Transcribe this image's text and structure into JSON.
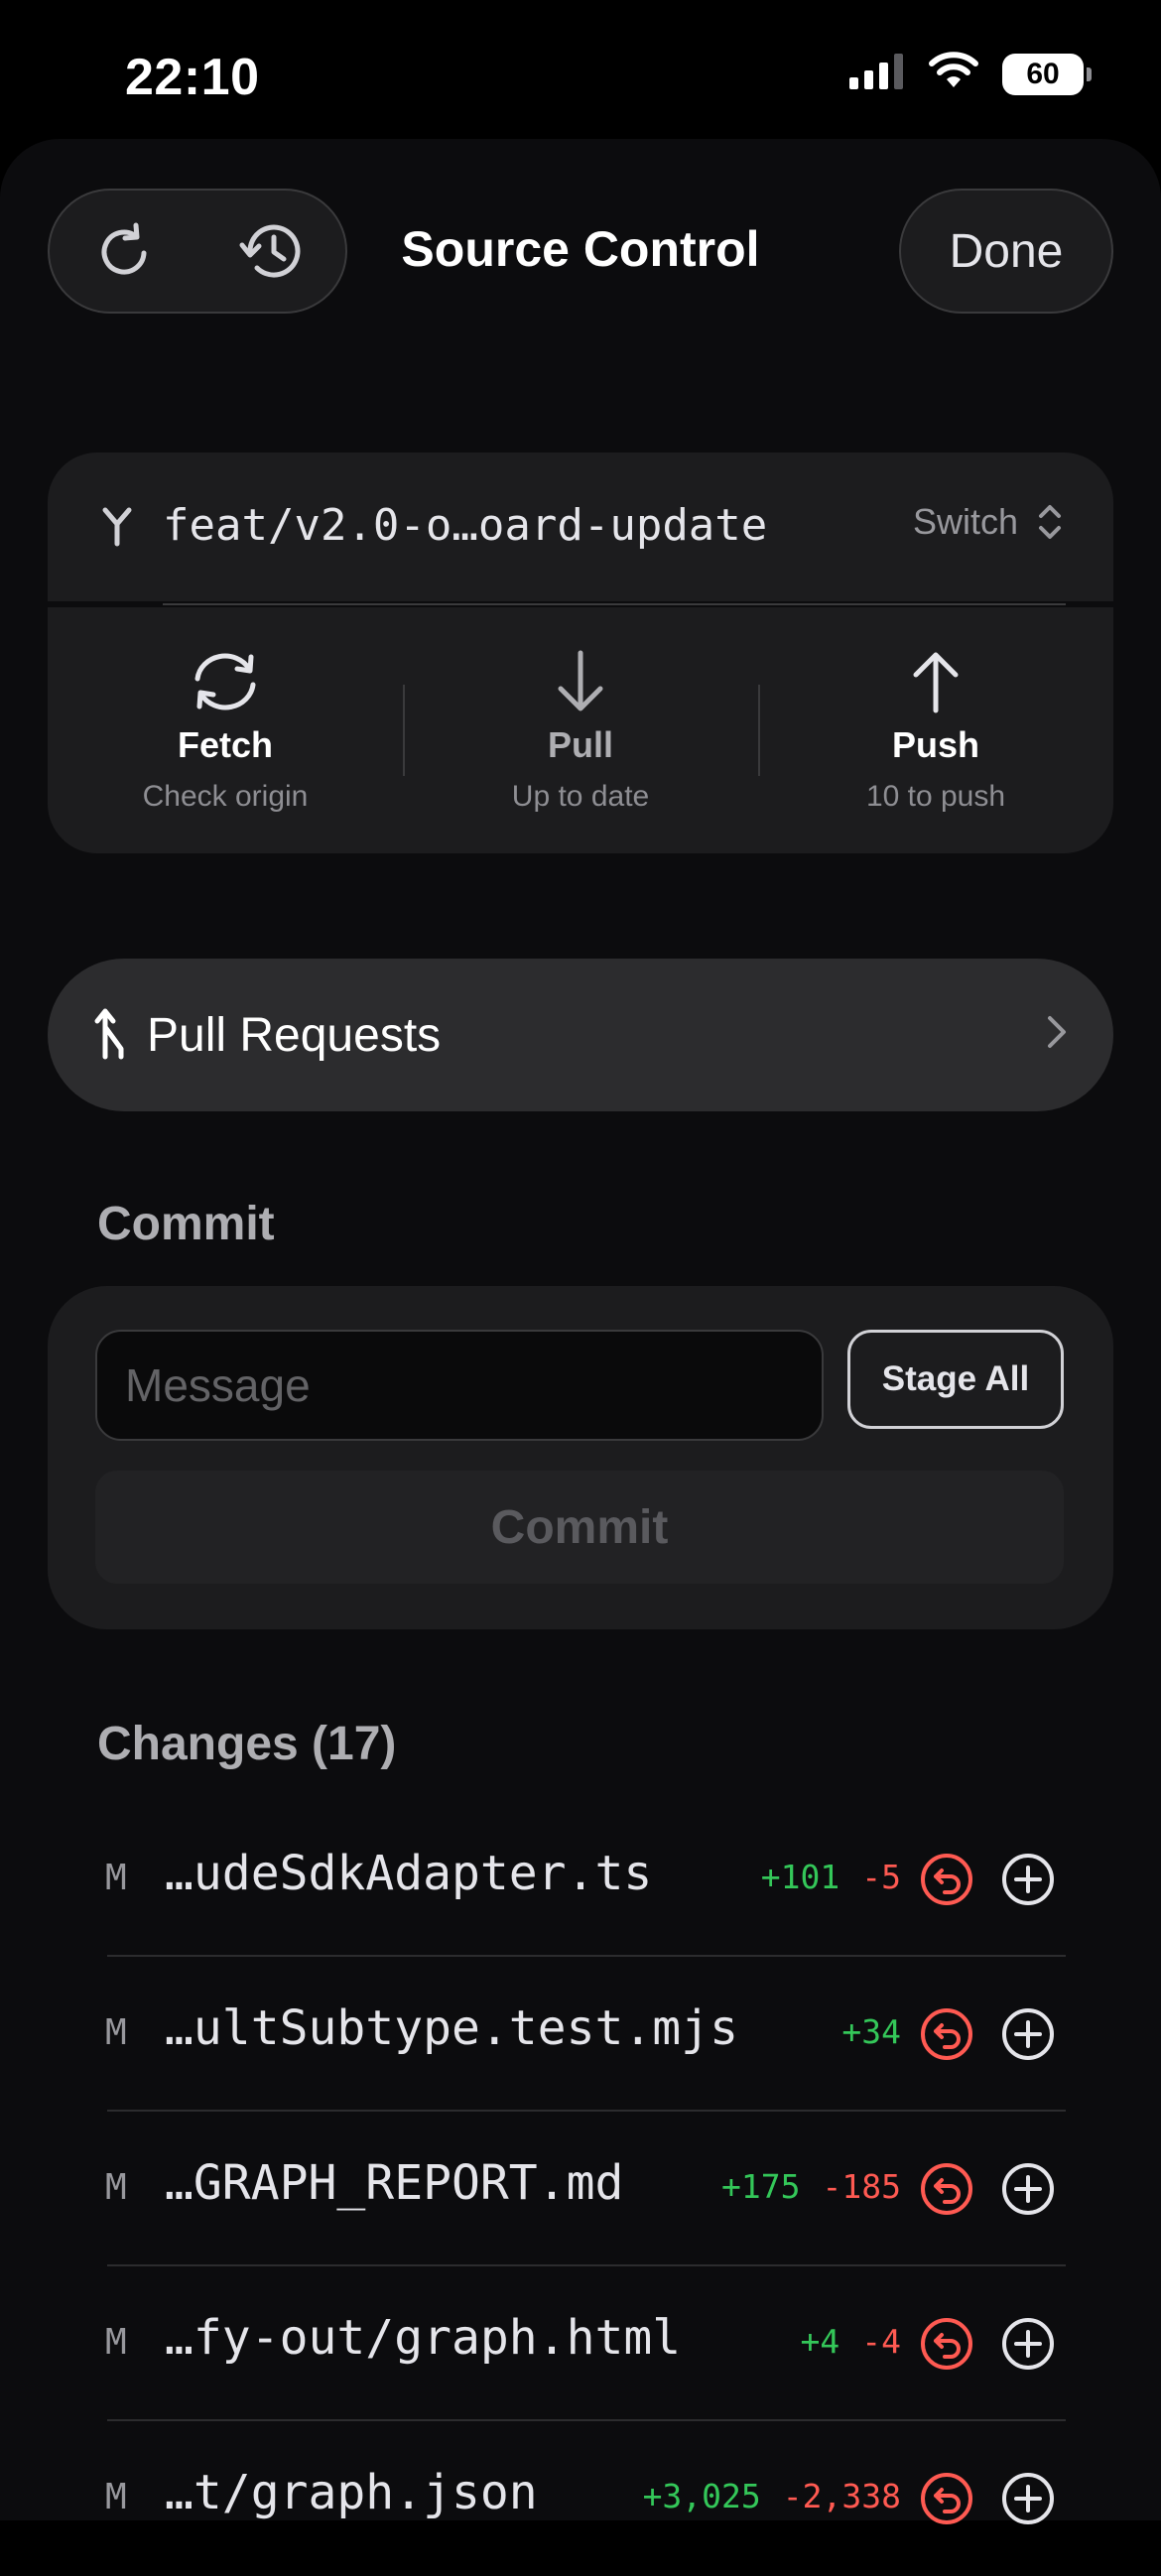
{
  "status_bar": {
    "time": "22:10",
    "battery": "60",
    "icons": [
      "cellular-signal-icon",
      "wifi-icon",
      "battery-icon"
    ]
  },
  "header": {
    "title": "Source Control",
    "done_label": "Done",
    "left_buttons": [
      "refresh-icon",
      "history-icon"
    ]
  },
  "branch": {
    "name": "feat/v2.0-o…oard-update",
    "switch_label": "Switch"
  },
  "sync_actions": [
    {
      "label": "Fetch",
      "sub": "Check origin",
      "icon": "fetch-icon"
    },
    {
      "label": "Pull",
      "sub": "Up to date",
      "icon": "arrow-down-icon"
    },
    {
      "label": "Push",
      "sub": "10 to push",
      "icon": "arrow-up-icon"
    }
  ],
  "pull_requests": {
    "label": "Pull Requests"
  },
  "commit": {
    "section_title": "Commit",
    "message_placeholder": "Message",
    "stage_all_label": "Stage All",
    "commit_label": "Commit"
  },
  "changes": {
    "section_title": "Changes (17)",
    "items": [
      {
        "status": "M",
        "file": "…udeSdkAdapter.ts",
        "added": "+101",
        "removed": "-5"
      },
      {
        "status": "M",
        "file": "…ultSubtype.test.mjs",
        "added": "+34",
        "removed": ""
      },
      {
        "status": "M",
        "file": "…GRAPH_REPORT.md",
        "added": "+175",
        "removed": "-185"
      },
      {
        "status": "M",
        "file": "…fy-out/graph.html",
        "added": "+4",
        "removed": "-4"
      },
      {
        "status": "M",
        "file": "…t/graph.json",
        "added": "+3,025",
        "removed": "-2,338"
      }
    ]
  },
  "colors": {
    "added": "#34c759",
    "removed": "#ff5a52",
    "card": "#1c1c1e",
    "background": "#0c0c0e"
  }
}
